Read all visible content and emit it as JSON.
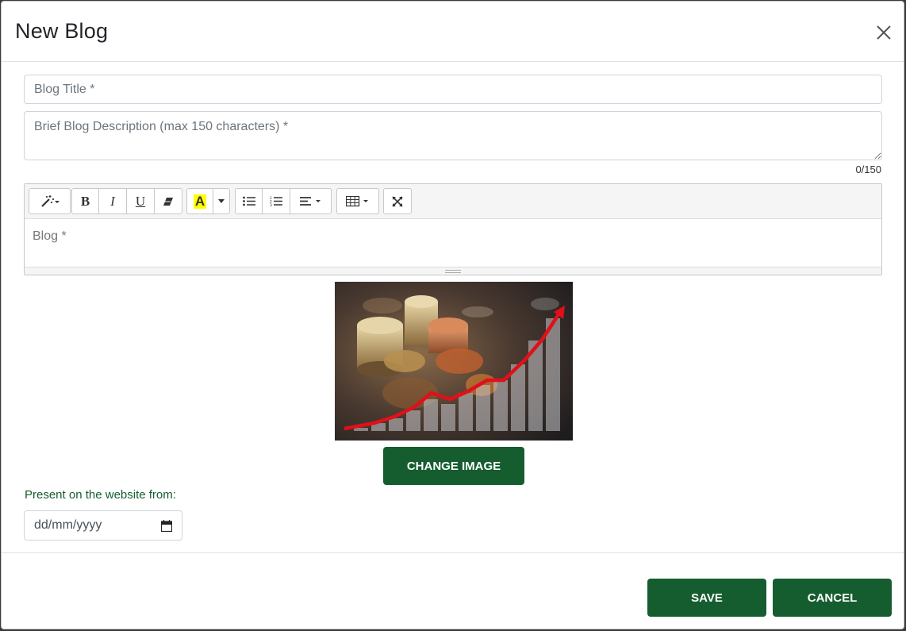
{
  "modal": {
    "title": "New Blog",
    "close_icon": "close-icon"
  },
  "form": {
    "title_placeholder": "Blog Title *",
    "title_value": "",
    "description_placeholder": "Brief Blog Description (max 150 characters) *",
    "description_value": "",
    "char_count": "0/150",
    "editor_placeholder": "Blog *"
  },
  "toolbar": {
    "icons": [
      "magic-wand-icon",
      "bold-icon",
      "italic-icon",
      "underline-icon",
      "eraser-icon",
      "highlight-color-icon",
      "unordered-list-icon",
      "ordered-list-icon",
      "align-icon",
      "table-icon",
      "fullscreen-icon"
    ],
    "bold": "B",
    "italic": "I",
    "underline": "U",
    "highlight": "A"
  },
  "image": {
    "description_icon": "coins-growth-chart-image",
    "change_label": "CHANGE IMAGE"
  },
  "schedule": {
    "label": "Present on the website from:",
    "date_placeholder": "dd/mm/yyyy"
  },
  "footer": {
    "save_label": "SAVE",
    "cancel_label": "CANCEL"
  },
  "colors": {
    "brand_green": "#155d2f",
    "highlight_yellow": "#ffff00",
    "trend_red": "#e0101a"
  }
}
